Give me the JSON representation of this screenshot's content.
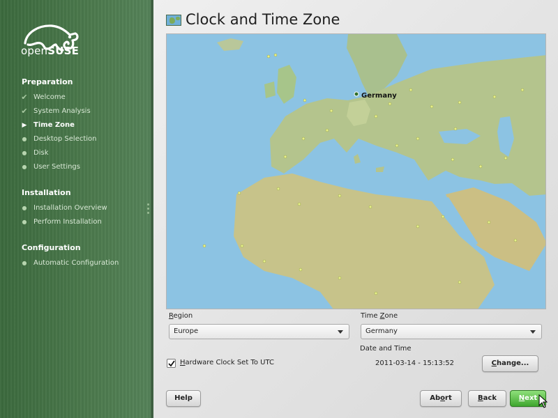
{
  "brand": {
    "logo_light": "open",
    "logo_bold": "SUSE"
  },
  "sidebar": {
    "sections": [
      {
        "title": "Preparation",
        "items": [
          {
            "label": "Welcome",
            "state": "done"
          },
          {
            "label": "System Analysis",
            "state": "done"
          },
          {
            "label": "Time Zone",
            "state": "current"
          },
          {
            "label": "Desktop Selection",
            "state": "pending"
          },
          {
            "label": "Disk",
            "state": "pending"
          },
          {
            "label": "User Settings",
            "state": "pending"
          }
        ]
      },
      {
        "title": "Installation",
        "items": [
          {
            "label": "Installation Overview",
            "state": "pending"
          },
          {
            "label": "Perform Installation",
            "state": "pending"
          }
        ]
      },
      {
        "title": "Configuration",
        "items": [
          {
            "label": "Automatic Configuration",
            "state": "pending"
          }
        ]
      }
    ]
  },
  "main": {
    "title": "Clock and Time Zone",
    "map": {
      "selected_label": "Germany"
    },
    "region": {
      "label_mnemonic": "R",
      "label_rest": "egion",
      "value": "Europe"
    },
    "timezone": {
      "label_prefix": "Time ",
      "label_mnemonic": "Z",
      "label_rest": "one",
      "value": "Germany"
    },
    "date_time": {
      "label": "Date and Time",
      "value": "2011-03-14 - 15:13:52"
    },
    "hw_clock": {
      "label_mnemonic": "H",
      "label_rest": "ardware Clock Set To UTC",
      "checked": true
    },
    "change_button": {
      "mnemonic": "C",
      "rest": "hange..."
    }
  },
  "footer": {
    "help": "Help",
    "abort": {
      "prefix": "Ab",
      "mnemonic": "o",
      "rest": "rt"
    },
    "back": {
      "mnemonic": "B",
      "rest": "ack"
    },
    "next": {
      "mnemonic": "N",
      "rest": "ext"
    }
  },
  "colors": {
    "sidebar_green": "#4c7a4d",
    "next_green": "#3fa62e",
    "sea": "#8cc3e3",
    "land": "#c7c38a"
  },
  "icons": {
    "done": "check-icon",
    "current": "play-arrow-icon",
    "pending": "bullet-icon"
  }
}
